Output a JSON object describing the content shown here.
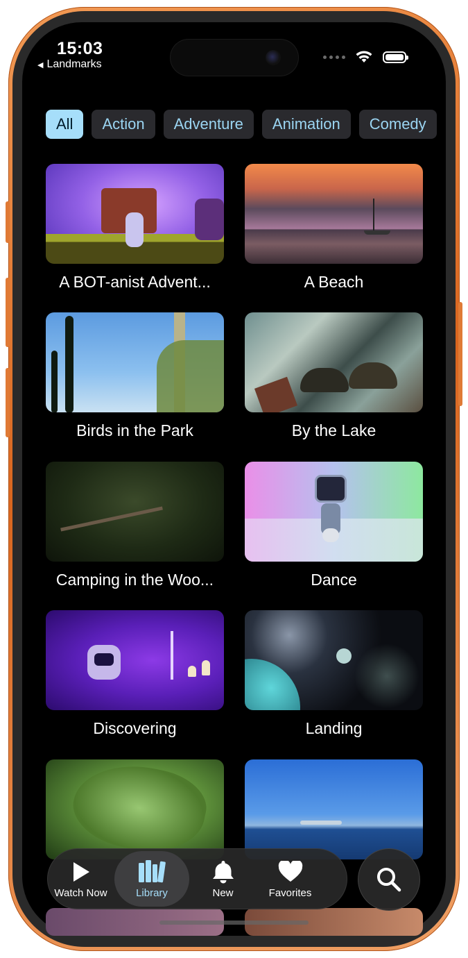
{
  "status": {
    "time": "15:03",
    "back_app": "Landmarks"
  },
  "categories": [
    {
      "label": "All",
      "selected": true
    },
    {
      "label": "Action",
      "selected": false
    },
    {
      "label": "Adventure",
      "selected": false
    },
    {
      "label": "Animation",
      "selected": false
    },
    {
      "label": "Comedy",
      "selected": false
    }
  ],
  "videos": [
    {
      "title": "A BOT-anist Advent..."
    },
    {
      "title": "A Beach"
    },
    {
      "title": "Birds in the Park"
    },
    {
      "title": "By the Lake"
    },
    {
      "title": "Camping in the Woo..."
    },
    {
      "title": "Dance"
    },
    {
      "title": "Discovering"
    },
    {
      "title": "Landing"
    }
  ],
  "tabs": [
    {
      "label": "Watch Now",
      "icon": "play-icon",
      "selected": false
    },
    {
      "label": "Library",
      "icon": "books-icon",
      "selected": true
    },
    {
      "label": "New",
      "icon": "bell-icon",
      "selected": false
    },
    {
      "label": "Favorites",
      "icon": "heart-icon",
      "selected": false
    }
  ],
  "search": {
    "icon": "search-icon"
  },
  "colors": {
    "accent": "#a6defa",
    "frame": "#e07a35"
  }
}
